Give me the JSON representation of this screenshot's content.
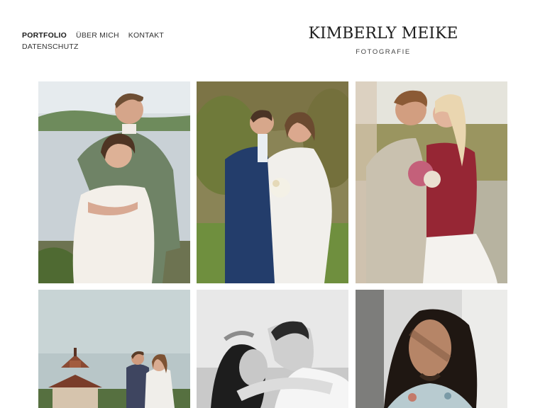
{
  "nav": {
    "items": [
      {
        "label": "PORTFOLIO",
        "active": true
      },
      {
        "label": "ÜBER MICH",
        "active": false
      },
      {
        "label": "KONTAKT",
        "active": false
      },
      {
        "label": "DATENSCHUTZ",
        "active": false
      }
    ]
  },
  "brand": {
    "name": "KIMBERLY MEIKE",
    "subtitle": "FOTOGRAFIE"
  },
  "gallery": {
    "photos": [
      {
        "subject": "couple-embrace-lakeside"
      },
      {
        "subject": "couple-standing-garden"
      },
      {
        "subject": "couple-kiss-field"
      },
      {
        "subject": "couple-tower-landscape"
      },
      {
        "subject": "couple-kiss-bw"
      },
      {
        "subject": "portrait-man-long-hair"
      }
    ]
  },
  "colors": {
    "background": "#ffffff",
    "text": "#222222"
  }
}
